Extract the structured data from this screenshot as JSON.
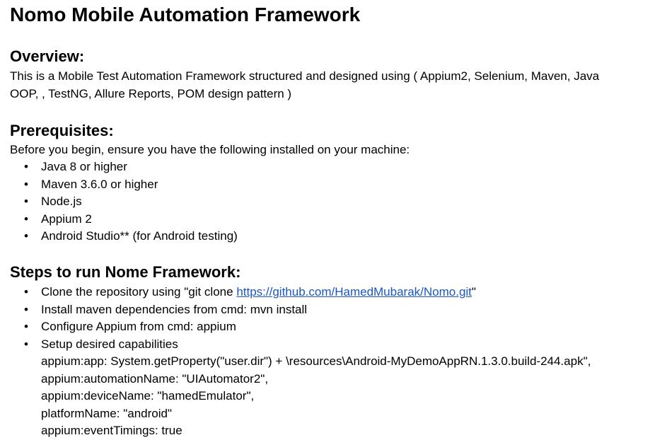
{
  "title": "Nomo Mobile Automation Framework",
  "overview": {
    "heading": "Overview:",
    "line1": "This is a Mobile Test Automation Framework structured and designed using ( Appium2, Selenium, Maven, Java",
    "line2": "OOP, , TestNG, Allure Reports, POM design pattern )"
  },
  "prerequisites": {
    "heading": "Prerequisites:",
    "intro": "Before you begin, ensure you have the following installed on your machine:",
    "items": [
      "Java 8 or higher",
      "Maven 3.6.0 or higher",
      "Node.js",
      "Appium 2",
      "Android Studio** (for Android testing)"
    ]
  },
  "steps": {
    "heading": "Steps to run Nome Framework:",
    "clone_prefix": "Clone the repository using \"git clone ",
    "clone_link": "https://github.com/HamedMubarak/Nomo.git",
    "clone_suffix": "\"",
    "install": "Install maven dependencies from cmd: mvn install",
    "configure": "Configure Appium from cmd: appium",
    "setup": "Setup desired capabilities",
    "capabilities": [
      "appium:app: System.getProperty(\"user.dir\") + \\resources\\Android-MyDemoAppRN.1.3.0.build-244.apk\",",
      "appium:automationName: \"UIAutomator2\",",
      "appium:deviceName: \"hamedEmulator\",",
      "platformName: \"android\"",
      "appium:eventTimings: true"
    ]
  },
  "bullet_char": "•"
}
